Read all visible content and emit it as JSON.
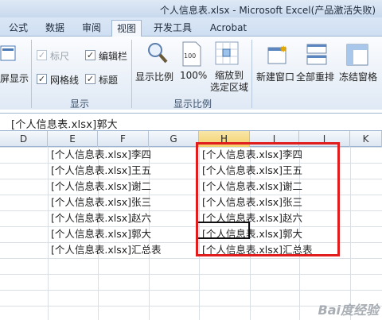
{
  "window": {
    "title": "个人信息表.xlsx - Microsoft Excel(产品激活失败)"
  },
  "tabs": [
    {
      "label": "公式",
      "active": false
    },
    {
      "label": "数据",
      "active": false
    },
    {
      "label": "审阅",
      "active": false
    },
    {
      "label": "视图",
      "active": true
    },
    {
      "label": "开发工具",
      "active": false
    },
    {
      "label": "Acrobat",
      "active": false
    }
  ],
  "ribbon": {
    "fullscreen_label": "屏显示",
    "show_group": {
      "label": "显示",
      "ruler": {
        "label": "标尺",
        "checked": true,
        "enabled": false
      },
      "formula_bar": {
        "label": "编辑栏",
        "checked": true,
        "enabled": true
      },
      "gridlines": {
        "label": "网格线",
        "checked": true,
        "enabled": true
      },
      "headings": {
        "label": "标题",
        "checked": true,
        "enabled": true
      }
    },
    "zoom_group": {
      "label": "显示比例",
      "zoom_label": "显示比例",
      "zoom100_label": "100%",
      "zoom100_icon": "100",
      "zoom_selection_label_1": "缩放到",
      "zoom_selection_label_2": "选定区域"
    },
    "window_group": {
      "new_window_label": "新建窗口",
      "arrange_all_label": "全部重排",
      "freeze_panes_label": "冻结窗格"
    },
    "checkmark": "✓"
  },
  "formula_bar": {
    "content": "[个人信息表.xlsx]郭大"
  },
  "columns": [
    "D",
    "E",
    "F",
    "G",
    "H",
    "I",
    "J",
    "K"
  ],
  "selected_column": "H",
  "cells": {
    "E_col": [
      "[个人信息表.xlsx]李四",
      "[个人信息表.xlsx]王五",
      "[个人信息表.xlsx]谢二",
      "[个人信息表.xlsx]张三",
      "[个人信息表.xlsx]赵六",
      "[个人信息表.xlsx]郭大",
      "[个人信息表.xlsx]汇总表"
    ],
    "H_col": [
      "[个人信息表.xlsx]李四",
      "[个人信息表.xlsx]王五",
      "[个人信息表.xlsx]谢二",
      "[个人信息表.xlsx]张三",
      "[个人信息表.xlsx]赵六",
      "[个人信息表.xlsx]郭大",
      "[个人信息表.xlsx]汇总表"
    ]
  },
  "watermark": "Bai度经验",
  "colors": {
    "highlight": "#e01c1c",
    "accent": "#2b579a"
  }
}
